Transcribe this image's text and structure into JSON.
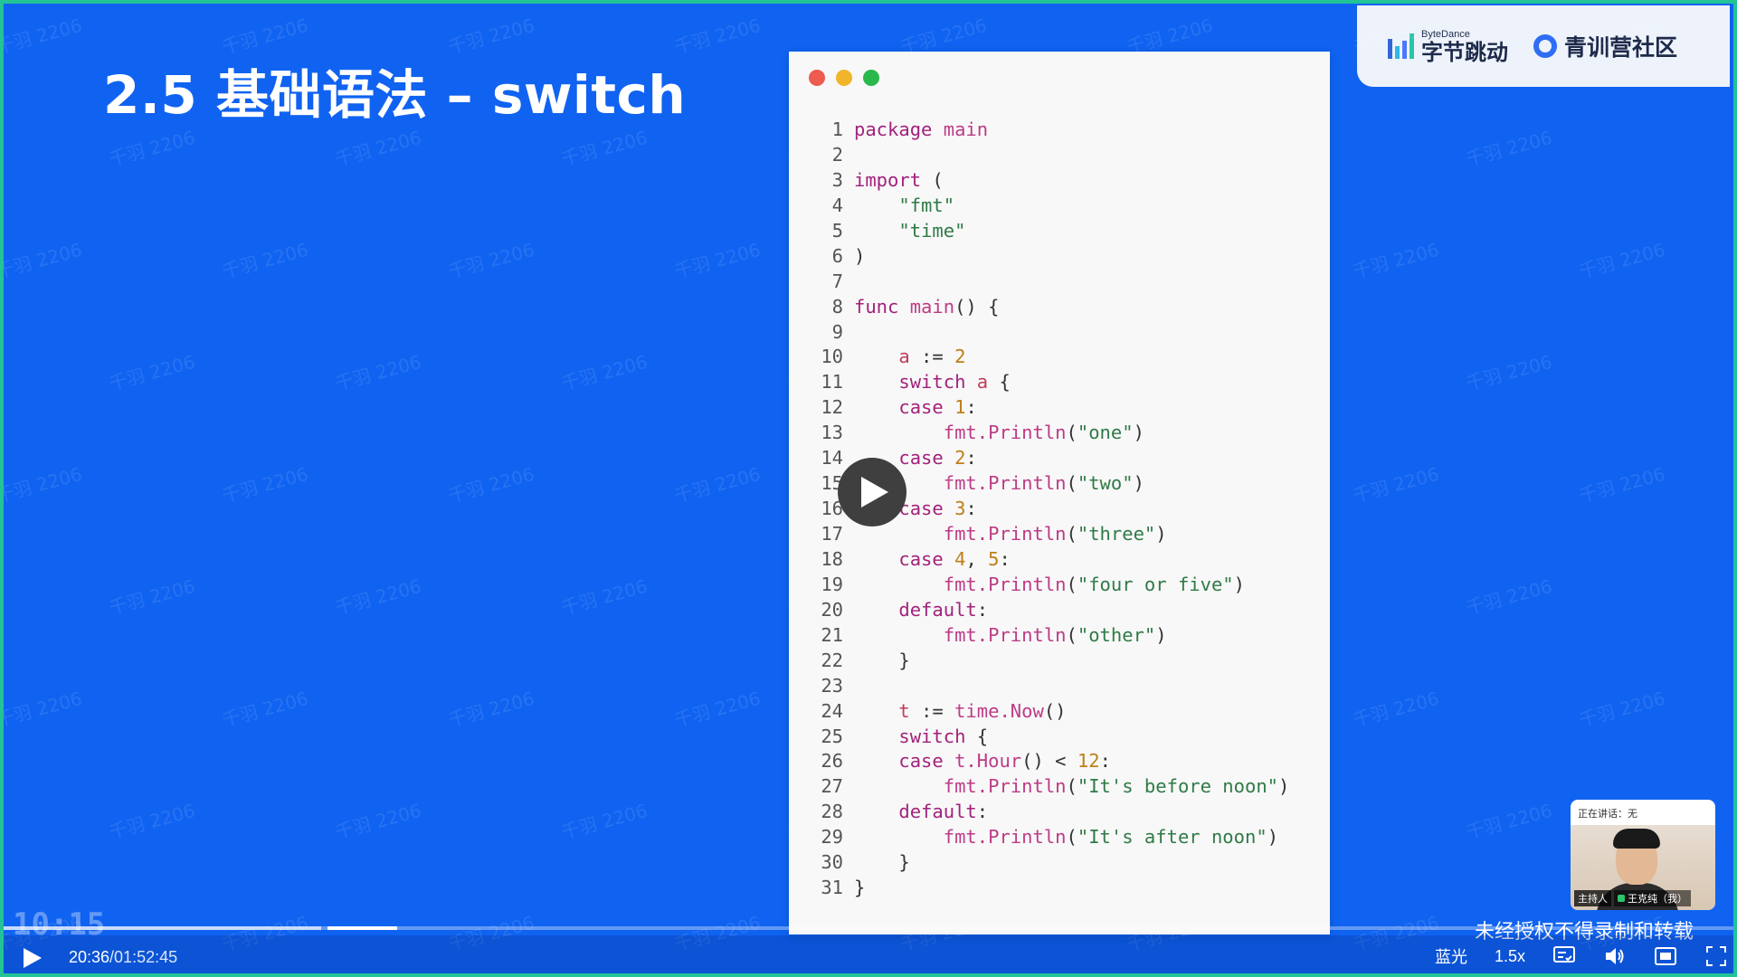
{
  "slide": {
    "title": "2.5 基础语法 – switch"
  },
  "brand": {
    "company_en": "ByteDance",
    "company_cn": "字节跳动",
    "community": "青训营社区"
  },
  "watermark_text": "千羽 2206",
  "code": {
    "lines": [
      {
        "n": "1",
        "html": "<span class=\"kw\">package</span> <span class=\"fn\">main</span>"
      },
      {
        "n": "2",
        "html": ""
      },
      {
        "n": "3",
        "html": "<span class=\"kw\">import</span> ("
      },
      {
        "n": "4",
        "html": "    <span class=\"str\">\"fmt\"</span>"
      },
      {
        "n": "5",
        "html": "    <span class=\"str\">\"time\"</span>"
      },
      {
        "n": "6",
        "html": ")"
      },
      {
        "n": "7",
        "html": ""
      },
      {
        "n": "8",
        "html": "<span class=\"kw\">func</span> <span class=\"fn\">main</span>() {"
      },
      {
        "n": "9",
        "html": ""
      },
      {
        "n": "10",
        "html": "    <span class=\"id\">a</span> := <span class=\"num\">2</span>"
      },
      {
        "n": "11",
        "html": "    <span class=\"kw\">switch</span> <span class=\"id\">a</span> {"
      },
      {
        "n": "12",
        "html": "    <span class=\"kw\">case</span> <span class=\"num\">1</span>:"
      },
      {
        "n": "13",
        "html": "        <span class=\"fn\">fmt.Println</span>(<span class=\"str\">\"one\"</span>)"
      },
      {
        "n": "14",
        "html": "    <span class=\"kw\">case</span> <span class=\"num\">2</span>:"
      },
      {
        "n": "15",
        "html": "        <span class=\"fn\">fmt.Println</span>(<span class=\"str\">\"two\"</span>)"
      },
      {
        "n": "16",
        "html": "    <span class=\"kw\">case</span> <span class=\"num\">3</span>:"
      },
      {
        "n": "17",
        "html": "        <span class=\"fn\">fmt.Println</span>(<span class=\"str\">\"three\"</span>)"
      },
      {
        "n": "18",
        "html": "    <span class=\"kw\">case</span> <span class=\"num\">4</span>, <span class=\"num\">5</span>:"
      },
      {
        "n": "19",
        "html": "        <span class=\"fn\">fmt.Println</span>(<span class=\"str\">\"four or five\"</span>)"
      },
      {
        "n": "20",
        "html": "    <span class=\"kw\">default</span>:"
      },
      {
        "n": "21",
        "html": "        <span class=\"fn\">fmt.Println</span>(<span class=\"str\">\"other\"</span>)"
      },
      {
        "n": "22",
        "html": "    }"
      },
      {
        "n": "23",
        "html": ""
      },
      {
        "n": "24",
        "html": "    <span class=\"id\">t</span> := <span class=\"fn\">time.Now</span>()"
      },
      {
        "n": "25",
        "html": "    <span class=\"kw\">switch</span> {"
      },
      {
        "n": "26",
        "html": "    <span class=\"kw\">case</span> <span class=\"fn\">t.Hour</span>() &lt; <span class=\"num\">12</span>:"
      },
      {
        "n": "27",
        "html": "        <span class=\"fn\">fmt.Println</span>(<span class=\"str\">\"It's before noon\"</span>)"
      },
      {
        "n": "28",
        "html": "    <span class=\"kw\">default</span>:"
      },
      {
        "n": "29",
        "html": "        <span class=\"fn\">fmt.Println</span>(<span class=\"str\">\"It's after noon\"</span>)"
      },
      {
        "n": "30",
        "html": "    }"
      },
      {
        "n": "31",
        "html": "}"
      }
    ]
  },
  "speaker": {
    "status": "正在讲话：无",
    "host_tag": "主持人",
    "name": "王克纯（我）"
  },
  "player": {
    "clock_overlay": "10:15",
    "current_time": "20:36",
    "total_time": "/01:52:45",
    "progress_fraction": 0.1826,
    "buffer_start_fraction": 0.1866,
    "buffer_end_fraction": 0.2266,
    "copyright_notice": "未经授权不得录制和转载",
    "quality": "蓝光",
    "speed": "1.5x",
    "icons": {
      "play": "play-icon",
      "subtitles": "subtitles-icon",
      "volume": "volume-icon",
      "picture_in_picture": "pip-icon",
      "fullscreen": "fullscreen-icon"
    }
  },
  "colors": {
    "slide_background": "#1063f1",
    "frame_border": "#21c397",
    "code_keyword": "#a2227b",
    "code_string": "#2f7a46",
    "code_number": "#c07d18"
  }
}
